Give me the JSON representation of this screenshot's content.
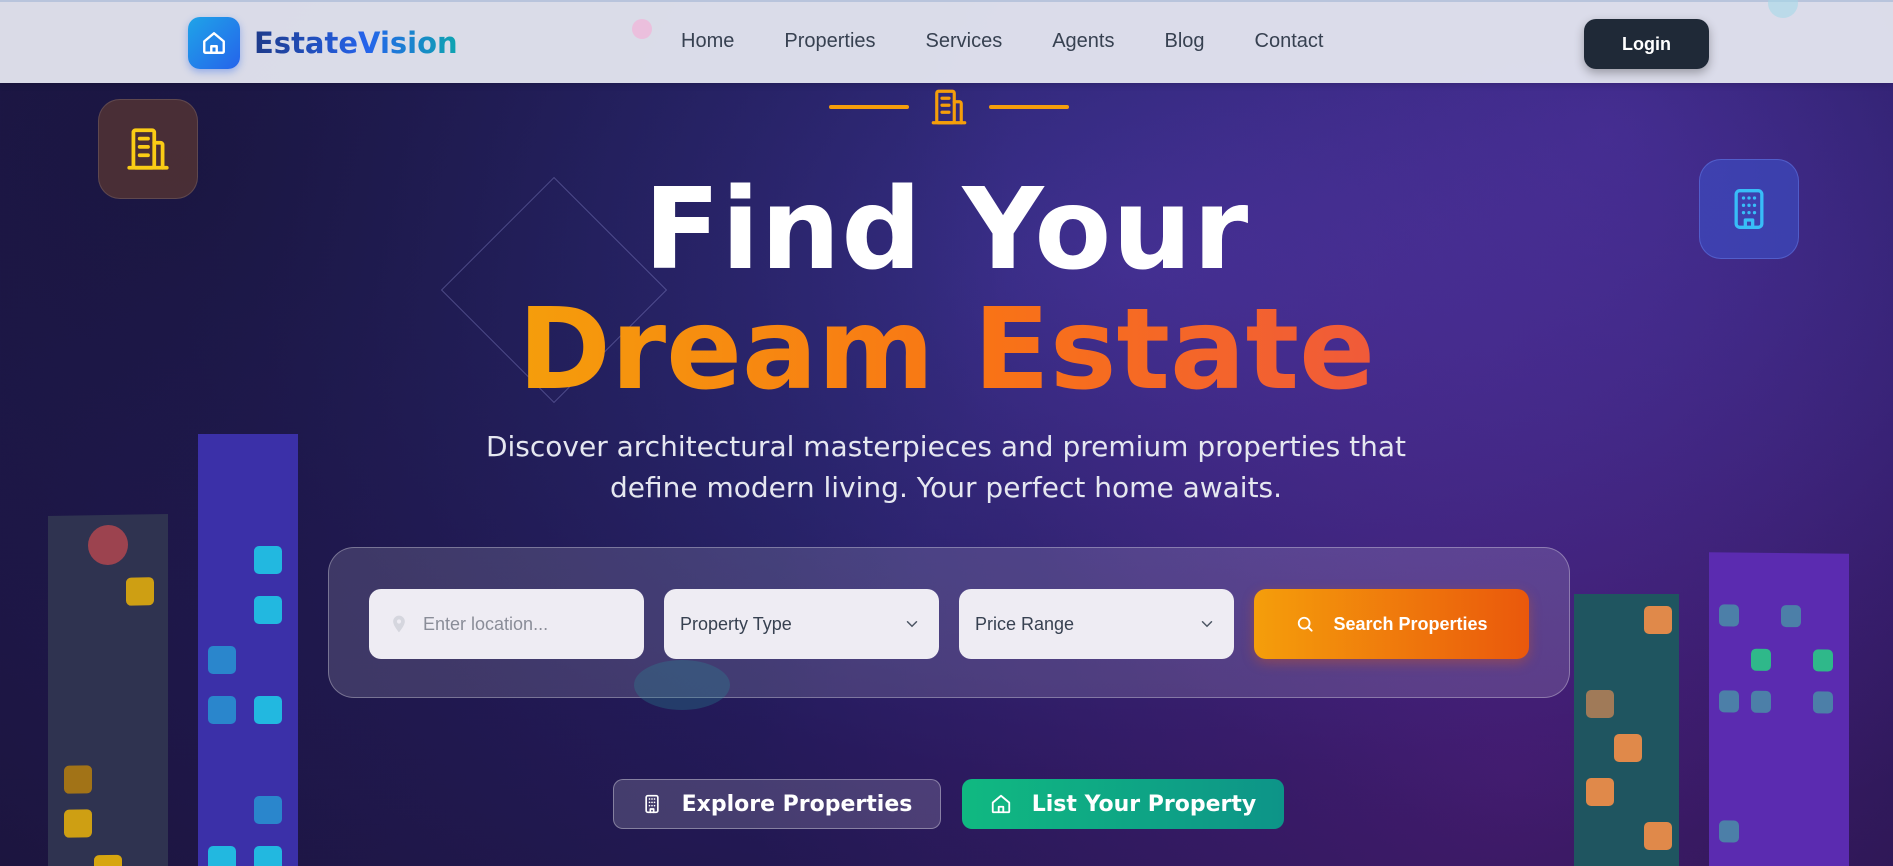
{
  "brand": {
    "name": "EstateVision",
    "logo_icon": "home-icon"
  },
  "nav": {
    "links": [
      "Home",
      "Properties",
      "Services",
      "Agents",
      "Blog",
      "Contact"
    ],
    "login_label": "Login"
  },
  "hero": {
    "title_line1": "Find Your",
    "title_line2": "Dream Estate",
    "subtitle": "Discover architectural masterpieces and premium properties that define modern living. Your perfect home awaits."
  },
  "search": {
    "location_placeholder": "Enter location...",
    "property_type_label": "Property Type",
    "price_range_label": "Price Range",
    "submit_label": "Search Properties"
  },
  "cta": {
    "explore_label": "Explore Properties",
    "list_label": "List Your Property"
  },
  "colors": {
    "accent_orange": "#f97316",
    "accent_amber": "#f59e0b",
    "accent_teal": "#10b981",
    "brand_blue": "#2563eb",
    "nav_dark": "#1f2937"
  }
}
